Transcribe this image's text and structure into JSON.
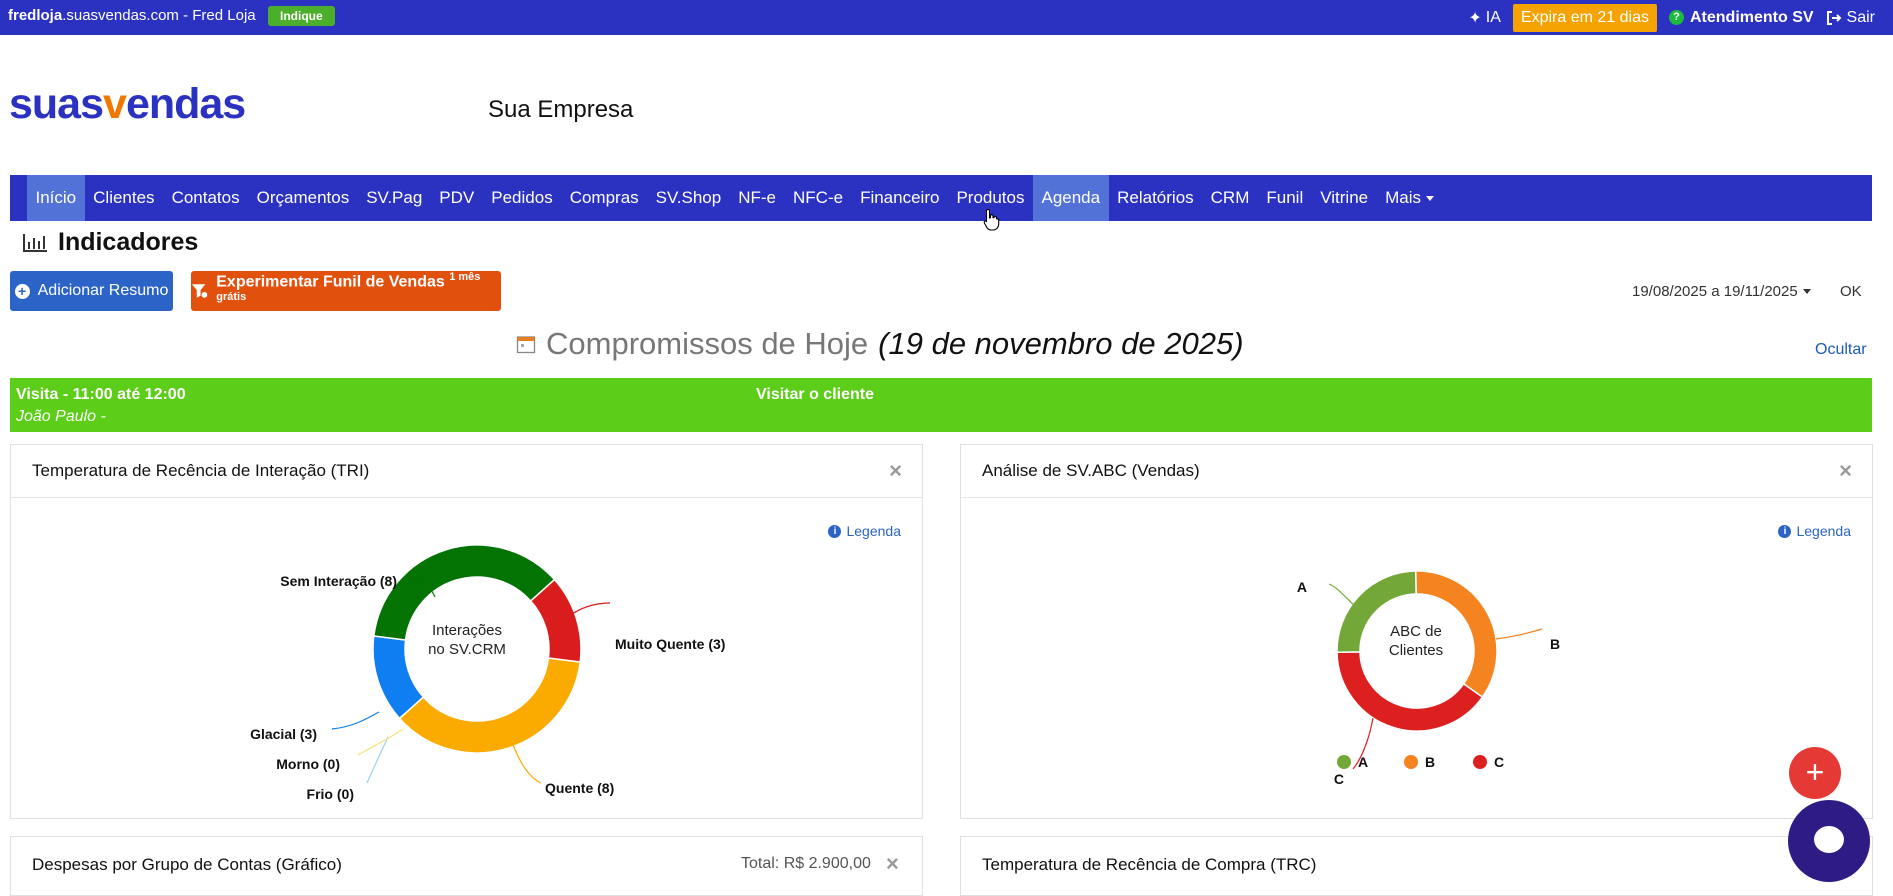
{
  "topbar": {
    "site_bold": "fredloja",
    "site_rest": ".suasvendas.com - Fred Loja",
    "indique_label": "Indique",
    "ia_label": "IA",
    "expira_label": "Expira em 21 dias",
    "atendimento_label": "Atendimento SV",
    "sair_label": "Sair",
    "colors": {
      "bar": "#2b31c0",
      "expira": "#f5a300",
      "indique": "#4caf2c"
    }
  },
  "brand": {
    "logo_part1": "suas",
    "logo_v": "v",
    "logo_part2": "endas",
    "company": "Sua Empresa"
  },
  "nav": {
    "items": [
      "Início",
      "Clientes",
      "Contatos",
      "Orçamentos",
      "SV.Pag",
      "PDV",
      "Pedidos",
      "Compras",
      "SV.Shop",
      "NF-e",
      "NFC-e",
      "Financeiro",
      "Produtos",
      "Agenda",
      "Relatórios",
      "CRM",
      "Funil",
      "Vitrine",
      "Mais"
    ],
    "active": "Início",
    "hover": "Agenda"
  },
  "page": {
    "title": "Indicadores"
  },
  "actions": {
    "add_resumo": "Adicionar Resumo",
    "funil_label": "Experimentar Funil de Vendas",
    "funil_sup": "1 mês grátis",
    "daterange": "19/08/2025 a 19/11/2025",
    "ok_label": "OK"
  },
  "compromissos": {
    "title": "Compromissos de Hoje",
    "date": "(19 de novembro de 2025)",
    "hide_label": "Ocultar",
    "item": {
      "type_time": "Visita - 11:00 até 12:00",
      "person": "João Paulo -",
      "description": "Visitar o cliente",
      "color": "#5ccd18"
    }
  },
  "panels": {
    "tri": {
      "title": "Temperatura de Recência de Interação (TRI)",
      "legend_link": "Legenda",
      "close": "×",
      "center_line1": "Interações",
      "center_line2": "no SV.CRM"
    },
    "abc": {
      "title": "Análise de SV.ABC (Vendas)",
      "legend_link": "Legenda",
      "close": "×",
      "center_line1": "ABC de",
      "center_line2": "Clientes",
      "legend": [
        "A",
        "B",
        "C"
      ]
    },
    "despesas": {
      "title": "Despesas por Grupo de Contas (Gráfico)",
      "total": "Total: R$ 2.900,00",
      "close": "×"
    },
    "trc": {
      "title": "Temperatura de Recência de Compra (TRC)"
    }
  },
  "chart_data": [
    {
      "type": "pie",
      "title": "Temperatura de Recência de Interação (TRI)",
      "categories": [
        "Sem Interação",
        "Muito Quente",
        "Quente",
        "Frio",
        "Morno",
        "Glacial"
      ],
      "values": [
        8,
        3,
        8,
        0,
        0,
        3
      ],
      "labels": [
        "Sem Interação (8)",
        "Muito Quente (3)",
        "Quente (8)",
        "Frio (0)",
        "Morno (0)",
        "Glacial (3)"
      ],
      "colors": [
        "#037303",
        "#d91c1c",
        "#fbab00",
        "#9cd0ef",
        "#f5e27a",
        "#0f7ef0"
      ]
    },
    {
      "type": "pie",
      "title": "Análise de SV.ABC (Vendas)",
      "categories": [
        "A",
        "B",
        "C"
      ],
      "values": [
        0.25,
        0.35,
        0.4
      ],
      "labels": [
        "A",
        "B",
        "C"
      ],
      "colors": [
        "#73a838",
        "#f5831f",
        "#dc2020"
      ]
    }
  ]
}
